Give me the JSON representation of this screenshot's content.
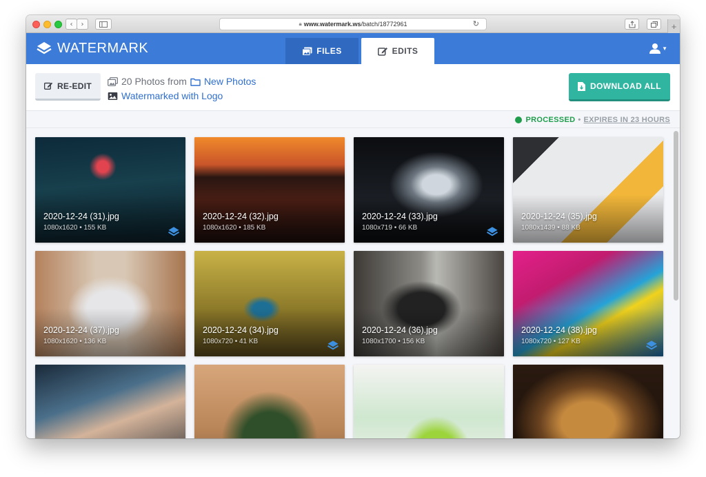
{
  "browser": {
    "url_domain": "www.watermark.ws",
    "url_path": "/batch/18772961"
  },
  "app": {
    "brand": "WATERMARK",
    "tabs": [
      {
        "label": "FILES",
        "active": false
      },
      {
        "label": "EDITS",
        "active": true
      }
    ]
  },
  "toolbar": {
    "reedit_label": "RE-EDIT",
    "photo_count_text": "20 Photos from",
    "folder_name": "New Photos",
    "watermark_text": "Watermarked with Logo",
    "download_label": "DOWNLOAD ALL"
  },
  "status": {
    "state": "PROCESSED",
    "separator": "•",
    "expires": "EXPIRES IN 23 HOURS",
    "color": "#1f9d4c"
  },
  "colors": {
    "brand_blue": "#3d7bd8",
    "download_teal": "#2fb5a0",
    "link_blue": "#2f6fcf"
  },
  "photos": [
    {
      "name": "2020-12-24 (31).jpg",
      "meta": "1080x1620 • 155 KB",
      "icon": "watermark-logo-icon"
    },
    {
      "name": "2020-12-24 (32).jpg",
      "meta": "1080x1620 • 185 KB",
      "icon": ""
    },
    {
      "name": "2020-12-24 (33).jpg",
      "meta": "1080x719 • 66 KB",
      "icon": "watermark-logo-icon"
    },
    {
      "name": "2020-12-24 (35).jpg",
      "meta": "1080x1439 • 88 KB",
      "icon": ""
    },
    {
      "name": "2020-12-24 (37).jpg",
      "meta": "1080x1620 • 136 KB",
      "icon": ""
    },
    {
      "name": "2020-12-24 (34).jpg",
      "meta": "1080x720 • 41 KB",
      "icon": "watermark-logo-icon"
    },
    {
      "name": "2020-12-24 (36).jpg",
      "meta": "1080x1700 • 156 KB",
      "icon": ""
    },
    {
      "name": "2020-12-24 (38).jpg",
      "meta": "1080x720 • 127 KB",
      "icon": "watermark-logo-icon"
    },
    {
      "name": "",
      "meta": "",
      "icon": ""
    },
    {
      "name": "",
      "meta": "",
      "icon": ""
    },
    {
      "name": "",
      "meta": "",
      "icon": ""
    },
    {
      "name": "",
      "meta": "",
      "icon": ""
    }
  ]
}
